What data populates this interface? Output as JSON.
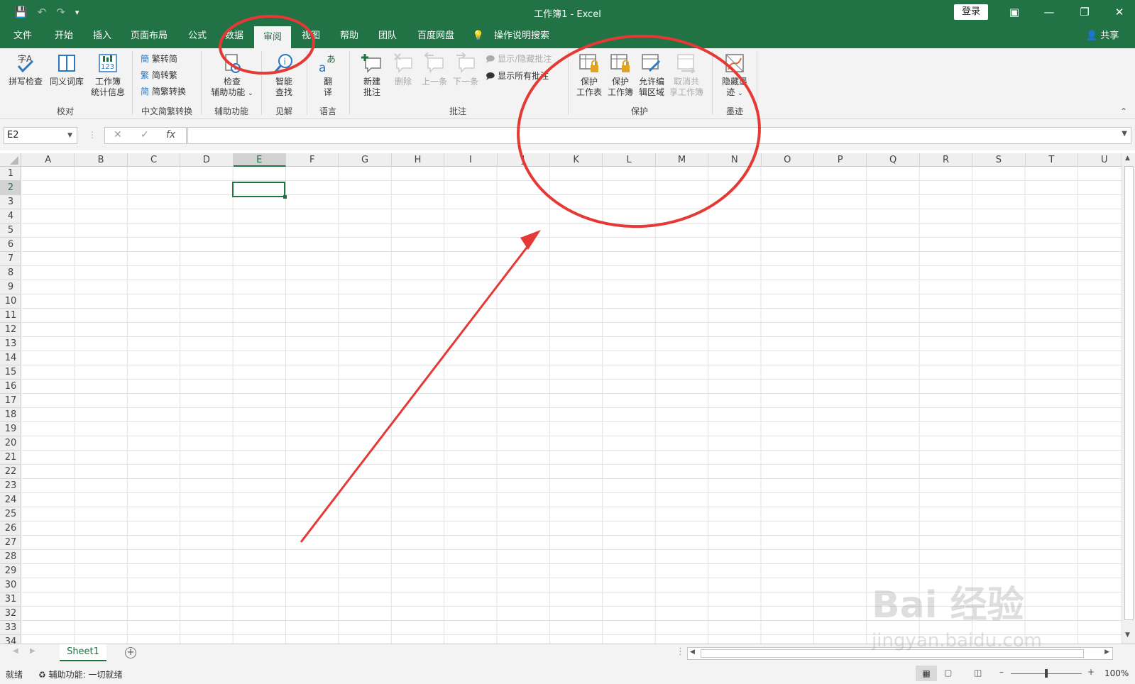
{
  "window": {
    "title": "工作簿1  -  Excel",
    "login": "登录"
  },
  "menu_tabs": [
    "文件",
    "开始",
    "插入",
    "页面布局",
    "公式",
    "数据",
    "审阅",
    "视图",
    "帮助",
    "团队",
    "百度网盘"
  ],
  "tell_me": "操作说明搜索",
  "share": "共享",
  "ribbon": {
    "proofing": {
      "spell": "拼写检查",
      "thesaurus": "同义词库",
      "stats_line1": "工作簿",
      "stats_line2": "统计信息",
      "label": "校对"
    },
    "chinese": {
      "t2s": "繁转简",
      "s2t": "简转繁",
      "convert": "简繁转换",
      "label": "中文简繁转换"
    },
    "access": {
      "line1": "检查",
      "line2": "辅助功能",
      "label": "辅助功能"
    },
    "insights": {
      "line1": "智能",
      "line2": "查找",
      "label": "见解"
    },
    "language": {
      "line1": "翻",
      "line2": "译",
      "label": "语言"
    },
    "comments": {
      "new_line1": "新建",
      "new_line2": "批注",
      "delete": "删除",
      "prev": "上一条",
      "next": "下一条",
      "show_hide": "显示/隐藏批注",
      "show_all": "显示所有批注",
      "label": "批注"
    },
    "protect": {
      "sheet_line1": "保护",
      "sheet_line2": "工作表",
      "book_line1": "保护",
      "book_line2": "工作簿",
      "allow_line1": "允许编",
      "allow_line2": "辑区域",
      "unshare_line1": "取消共",
      "unshare_line2": "享工作簿",
      "label": "保护"
    },
    "ink": {
      "line1": "隐藏墨",
      "line2": "迹",
      "label": "墨迹"
    }
  },
  "formula_bar": {
    "name_box": "E2",
    "fx": "fx",
    "cancel": "✕",
    "confirm": "✓",
    "value": ""
  },
  "columns": [
    "A",
    "B",
    "C",
    "D",
    "E",
    "F",
    "G",
    "H",
    "I",
    "J",
    "K",
    "L",
    "M",
    "N",
    "O",
    "P",
    "Q",
    "R",
    "S",
    "T",
    "U"
  ],
  "rows": [
    "1",
    "2",
    "3",
    "4",
    "5",
    "6",
    "7",
    "8",
    "9",
    "10",
    "11",
    "12",
    "13",
    "14",
    "15",
    "16",
    "17",
    "18",
    "19",
    "20",
    "21",
    "22",
    "23",
    "24",
    "25",
    "26",
    "27",
    "28",
    "29",
    "30",
    "31",
    "32",
    "33",
    "34"
  ],
  "selected": {
    "column": "E",
    "row": "2"
  },
  "sheet_tabs": [
    "Sheet1"
  ],
  "status": {
    "ready": "就绪",
    "accessibility": "辅助功能: 一切就绪",
    "zoom": "100%"
  },
  "watermark": {
    "line1": "Bai 经验",
    "line2": "jingyan.baidu.com"
  },
  "colors": {
    "accent": "#217346",
    "annotation": "#e53935"
  }
}
